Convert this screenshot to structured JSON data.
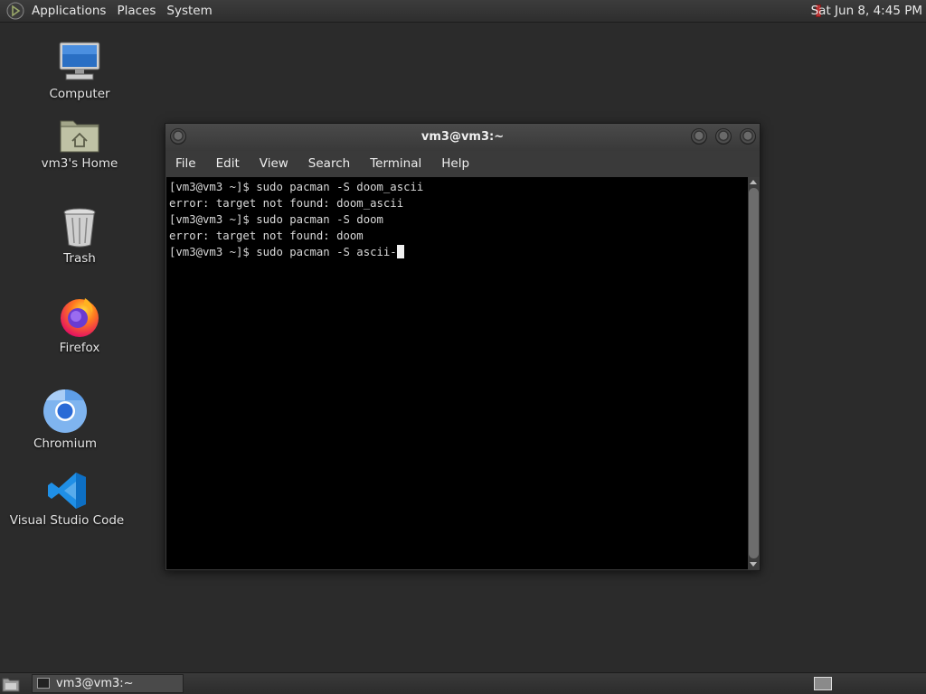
{
  "top_panel": {
    "menus": [
      "Applications",
      "Places",
      "System"
    ],
    "clock": "Sat Jun  8,  4:45 PM"
  },
  "desktop": {
    "icons": [
      {
        "label": "Computer",
        "icon": "computer-icon"
      },
      {
        "label": "vm3's Home",
        "icon": "home-folder-icon"
      },
      {
        "label": "Trash",
        "icon": "trash-icon"
      },
      {
        "label": "Firefox",
        "icon": "firefox-icon"
      },
      {
        "label": "Chromium",
        "icon": "chromium-icon"
      },
      {
        "label": "Visual Studio Code",
        "icon": "vscode-icon"
      }
    ]
  },
  "terminal": {
    "title": "vm3@vm3:~",
    "menus": [
      "File",
      "Edit",
      "View",
      "Search",
      "Terminal",
      "Help"
    ],
    "lines": [
      "[vm3@vm3 ~]$ sudo pacman -S doom_ascii",
      "error: target not found: doom_ascii",
      "[vm3@vm3 ~]$ sudo pacman -S doom",
      "error: target not found: doom",
      "[vm3@vm3 ~]$ sudo pacman -S ascii-"
    ]
  },
  "taskbar": {
    "task_label": "vm3@vm3:~"
  }
}
